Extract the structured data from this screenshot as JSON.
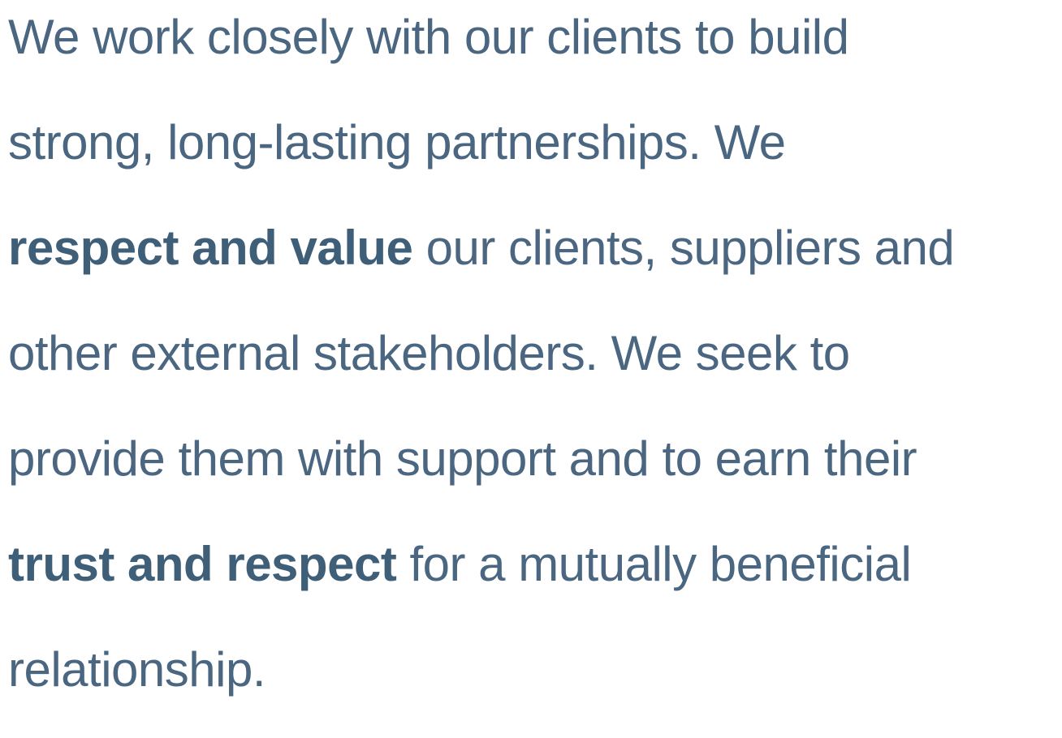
{
  "paragraph": {
    "lines": [
      [
        {
          "text": "We work closely with our clients to build",
          "style": "light"
        }
      ],
      [
        {
          "text": "strong, long-lasting partnerships. We",
          "style": "light"
        }
      ],
      [
        {
          "text": "respect and value",
          "style": "bold"
        },
        {
          "text": " our clients, suppliers and",
          "style": "light"
        }
      ],
      [
        {
          "text": "other external stakeholders. We seek to",
          "style": "light"
        }
      ],
      [
        {
          "text": "provide them with support and to earn their",
          "style": "light"
        }
      ],
      [
        {
          "text": "trust and respect",
          "style": "bold"
        },
        {
          "text": " for a mutually beneficial",
          "style": "light"
        }
      ],
      [
        {
          "text": "relationship.",
          "style": "light"
        }
      ]
    ]
  }
}
